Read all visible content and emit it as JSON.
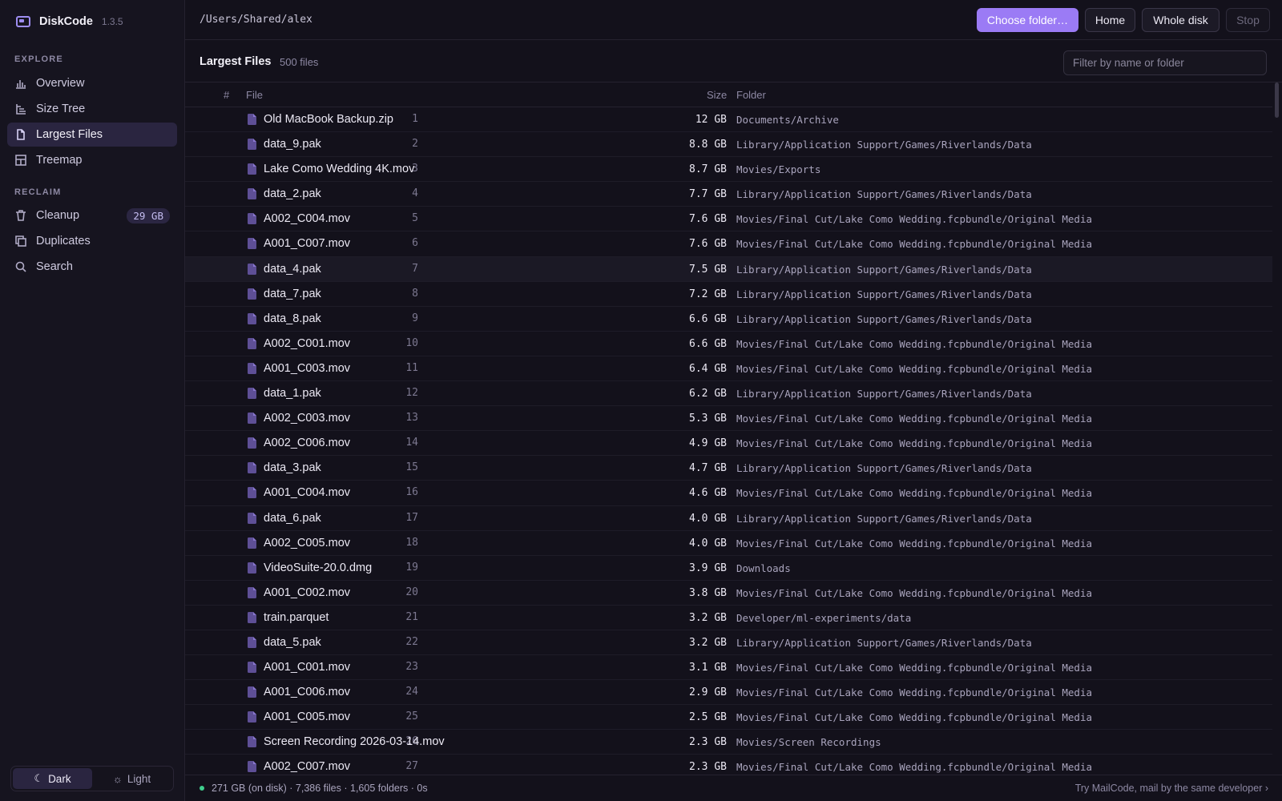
{
  "app": {
    "name": "DiskCode",
    "version": "1.3.5"
  },
  "sidebar": {
    "sections": [
      {
        "label": "EXPLORE",
        "items": [
          {
            "label": "Overview",
            "icon": "bar-chart-icon"
          },
          {
            "label": "Size Tree",
            "icon": "tree-list-icon"
          },
          {
            "label": "Largest Files",
            "icon": "file-icon",
            "active": true
          },
          {
            "label": "Treemap",
            "icon": "grid-icon"
          }
        ]
      },
      {
        "label": "RECLAIM",
        "items": [
          {
            "label": "Cleanup",
            "icon": "trash-icon",
            "badge": "29 GB"
          },
          {
            "label": "Duplicates",
            "icon": "copy-icon"
          },
          {
            "label": "Search",
            "icon": "search-icon"
          }
        ]
      }
    ],
    "theme": {
      "dark_label": "Dark",
      "light_label": "Light",
      "selected": "Dark"
    }
  },
  "topbar": {
    "path": "/Users/Shared/alex",
    "choose_folder_label": "Choose folder…",
    "home_label": "Home",
    "whole_disk_label": "Whole disk",
    "stop_label": "Stop"
  },
  "content": {
    "title": "Largest Files",
    "count": "500 files",
    "filter_placeholder": "Filter by name or folder"
  },
  "table": {
    "columns": {
      "num": "#",
      "file": "File",
      "size": "Size",
      "folder": "Folder"
    },
    "hover_row": 7,
    "rows": [
      {
        "num": "1",
        "name": "Old MacBook Backup.zip",
        "size": "12 GB",
        "folder": "Documents/Archive"
      },
      {
        "num": "2",
        "name": "data_9.pak",
        "size": "8.8 GB",
        "folder": "Library/Application Support/Games/Riverlands/Data"
      },
      {
        "num": "3",
        "name": "Lake Como Wedding 4K.mov",
        "size": "8.7 GB",
        "folder": "Movies/Exports"
      },
      {
        "num": "4",
        "name": "data_2.pak",
        "size": "7.7 GB",
        "folder": "Library/Application Support/Games/Riverlands/Data"
      },
      {
        "num": "5",
        "name": "A002_C004.mov",
        "size": "7.6 GB",
        "folder": "Movies/Final Cut/Lake Como Wedding.fcpbundle/Original Media"
      },
      {
        "num": "6",
        "name": "A001_C007.mov",
        "size": "7.6 GB",
        "folder": "Movies/Final Cut/Lake Como Wedding.fcpbundle/Original Media"
      },
      {
        "num": "7",
        "name": "data_4.pak",
        "size": "7.5 GB",
        "folder": "Library/Application Support/Games/Riverlands/Data"
      },
      {
        "num": "8",
        "name": "data_7.pak",
        "size": "7.2 GB",
        "folder": "Library/Application Support/Games/Riverlands/Data"
      },
      {
        "num": "9",
        "name": "data_8.pak",
        "size": "6.6 GB",
        "folder": "Library/Application Support/Games/Riverlands/Data"
      },
      {
        "num": "10",
        "name": "A002_C001.mov",
        "size": "6.6 GB",
        "folder": "Movies/Final Cut/Lake Como Wedding.fcpbundle/Original Media"
      },
      {
        "num": "11",
        "name": "A001_C003.mov",
        "size": "6.4 GB",
        "folder": "Movies/Final Cut/Lake Como Wedding.fcpbundle/Original Media"
      },
      {
        "num": "12",
        "name": "data_1.pak",
        "size": "6.2 GB",
        "folder": "Library/Application Support/Games/Riverlands/Data"
      },
      {
        "num": "13",
        "name": "A002_C003.mov",
        "size": "5.3 GB",
        "folder": "Movies/Final Cut/Lake Como Wedding.fcpbundle/Original Media"
      },
      {
        "num": "14",
        "name": "A002_C006.mov",
        "size": "4.9 GB",
        "folder": "Movies/Final Cut/Lake Como Wedding.fcpbundle/Original Media"
      },
      {
        "num": "15",
        "name": "data_3.pak",
        "size": "4.7 GB",
        "folder": "Library/Application Support/Games/Riverlands/Data"
      },
      {
        "num": "16",
        "name": "A001_C004.mov",
        "size": "4.6 GB",
        "folder": "Movies/Final Cut/Lake Como Wedding.fcpbundle/Original Media"
      },
      {
        "num": "17",
        "name": "data_6.pak",
        "size": "4.0 GB",
        "folder": "Library/Application Support/Games/Riverlands/Data"
      },
      {
        "num": "18",
        "name": "A002_C005.mov",
        "size": "4.0 GB",
        "folder": "Movies/Final Cut/Lake Como Wedding.fcpbundle/Original Media"
      },
      {
        "num": "19",
        "name": "VideoSuite-20.0.dmg",
        "size": "3.9 GB",
        "folder": "Downloads"
      },
      {
        "num": "20",
        "name": "A001_C002.mov",
        "size": "3.8 GB",
        "folder": "Movies/Final Cut/Lake Como Wedding.fcpbundle/Original Media"
      },
      {
        "num": "21",
        "name": "train.parquet",
        "size": "3.2 GB",
        "folder": "Developer/ml-experiments/data"
      },
      {
        "num": "22",
        "name": "data_5.pak",
        "size": "3.2 GB",
        "folder": "Library/Application Support/Games/Riverlands/Data"
      },
      {
        "num": "23",
        "name": "A001_C001.mov",
        "size": "3.1 GB",
        "folder": "Movies/Final Cut/Lake Como Wedding.fcpbundle/Original Media"
      },
      {
        "num": "24",
        "name": "A001_C006.mov",
        "size": "2.9 GB",
        "folder": "Movies/Final Cut/Lake Como Wedding.fcpbundle/Original Media"
      },
      {
        "num": "25",
        "name": "A001_C005.mov",
        "size": "2.5 GB",
        "folder": "Movies/Final Cut/Lake Como Wedding.fcpbundle/Original Media"
      },
      {
        "num": "26",
        "name": "Screen Recording 2026-03-14.mov",
        "size": "2.3 GB",
        "folder": "Movies/Screen Recordings"
      },
      {
        "num": "27",
        "name": "A002_C007.mov",
        "size": "2.3 GB",
        "folder": "Movies/Final Cut/Lake Como Wedding.fcpbundle/Original Media"
      }
    ]
  },
  "status": {
    "summary": "271 GB (on disk) · 7,386 files · 1,605 folders · 0s",
    "promo": "Try MailCode, mail by the same developer ›"
  },
  "colors": {
    "accent": "#9b7bf5",
    "background": "#13111b",
    "sidebar": "#16141f",
    "active_nav": "#2a2540",
    "status_dot": "#3fcf8e",
    "file_icon": "#6b5ba8"
  }
}
